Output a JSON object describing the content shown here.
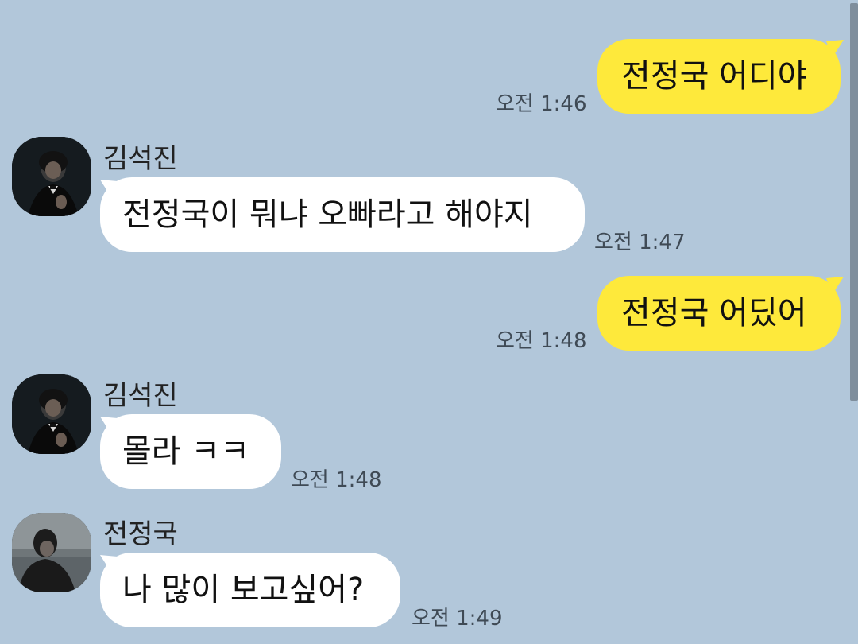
{
  "colors": {
    "background": "#b2c7da",
    "my_bubble": "#fee93b",
    "other_bubble": "#ffffff"
  },
  "messages": [
    {
      "from": "me",
      "text": "전정국 어디야",
      "time": "오전 1:46"
    },
    {
      "from": "other",
      "sender": "김석진",
      "avatar": "seokjin-avatar",
      "text": "전정국이 뭐냐 오빠라고 해야지",
      "time": "오전 1:47"
    },
    {
      "from": "me",
      "text": "전정국 어딨어",
      "time": "오전 1:48"
    },
    {
      "from": "other",
      "sender": "김석진",
      "avatar": "seokjin-avatar",
      "text": "몰라 ㅋㅋ",
      "time": "오전 1:48"
    },
    {
      "from": "other",
      "sender": "전정국",
      "avatar": "jungkook-avatar",
      "text": "나 많이 보고싶어?",
      "time": "오전 1:49"
    }
  ]
}
